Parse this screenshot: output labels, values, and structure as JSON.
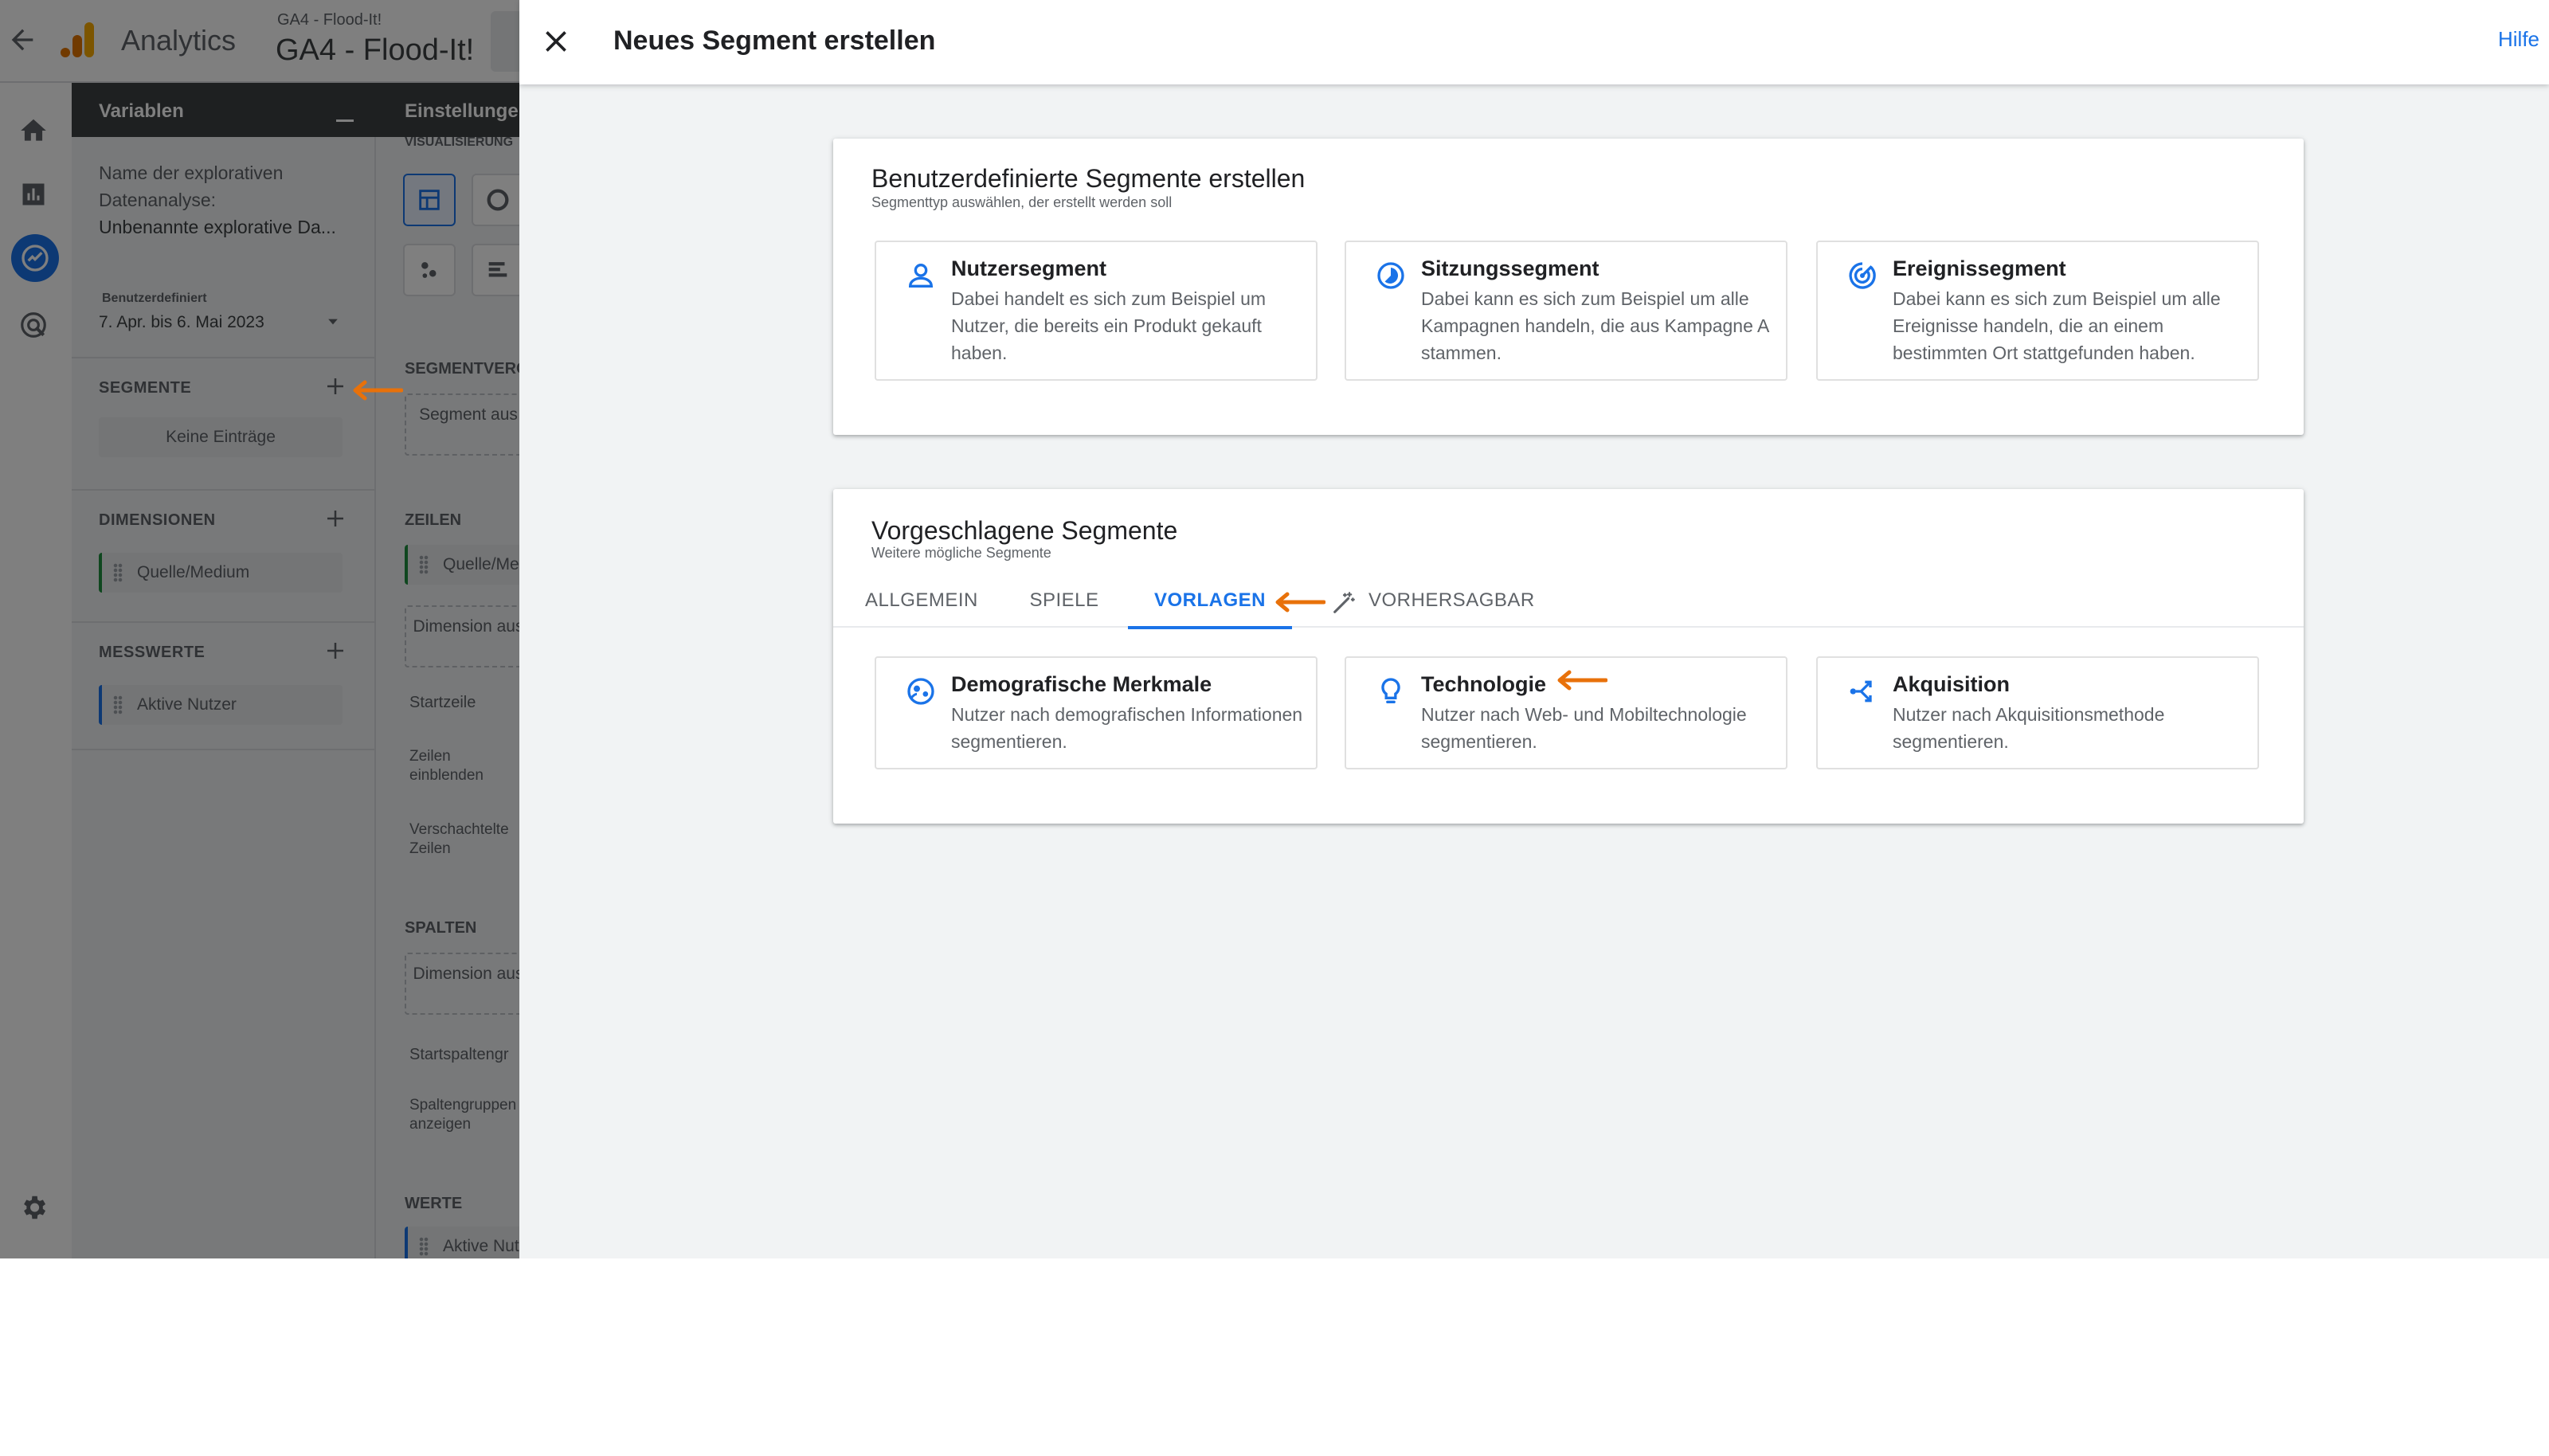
{
  "topbar": {
    "app_name": "Analytics",
    "property_small": "GA4 - Flood-It!",
    "property_big": "GA4 - Flood-It!"
  },
  "variables_panel": {
    "title": "Variablen",
    "exploration_name_label": "Name der explorativen Datenanalyse:",
    "exploration_name_value": "Unbenannte explorative Da...",
    "date_range_label": "Benutzerdefiniert",
    "date_range_value": "7. Apr. bis 6. Mai 2023",
    "segments_label": "SEGMENTE",
    "segments_empty": "Keine Einträge",
    "dimensions_label": "DIMENSIONEN",
    "dimension_item": "Quelle/Medium",
    "metrics_label": "MESSWERTE",
    "metric_item": "Aktive Nutzer"
  },
  "settings_panel": {
    "title": "Einstellungen",
    "visualization_label": "VISUALISIERUNG",
    "segment_compare_label": "SEGMENTVERG",
    "segment_drop": "Segment aus",
    "rows_label": "ZEILEN",
    "row_item": "Quelle/Me",
    "dimension_drop": "Dimension aus",
    "start_row": "Startzeile",
    "show_rows": "Zeilen einblenden",
    "nested_rows": "Verschachtelte Zeilen",
    "columns_label": "SPALTEN",
    "column_drop": "Dimension aus",
    "start_column_group": "Startspaltengr",
    "show_column_groups": "Spaltengruppen anzeigen",
    "values_label": "WERTE",
    "value_item": "Aktive Nut"
  },
  "dialog": {
    "title": "Neues Segment erstellen",
    "help": "Hilfe",
    "custom": {
      "title": "Benutzerdefinierte Segmente erstellen",
      "subtitle": "Segmenttyp auswählen, der erstellt werden soll",
      "options": [
        {
          "title": "Nutzersegment",
          "desc": "Dabei handelt es sich zum Beispiel um Nutzer, die bereits ein Produkt gekauft haben.",
          "icon": "person-icon"
        },
        {
          "title": "Sitzungssegment",
          "desc": "Dabei kann es sich zum Beispiel um alle Kampagnen handeln, die aus Kampagne A stammen.",
          "icon": "session-icon"
        },
        {
          "title": "Ereignissegment",
          "desc": "Dabei kann es sich zum Beispiel um alle Ereignisse handeln, die an einem bestimmten Ort stattgefunden haben.",
          "icon": "event-icon"
        }
      ]
    },
    "suggested": {
      "title": "Vorgeschlagene Segmente",
      "subtitle": "Weitere mögliche Segmente",
      "tabs": [
        "ALLGEMEIN",
        "SPIELE",
        "VORLAGEN",
        "VORHERSAGBAR"
      ],
      "active_tab": "VORLAGEN",
      "options": [
        {
          "title": "Demografische Merkmale",
          "desc": "Nutzer nach demografischen Informationen segmentieren.",
          "icon": "demographics-icon"
        },
        {
          "title": "Technologie",
          "desc": "Nutzer nach Web- und Mobiltechnologie segmentieren.",
          "icon": "lightbulb-icon"
        },
        {
          "title": "Akquisition",
          "desc": "Nutzer nach Akquisitionsmethode segmentieren.",
          "icon": "acquisition-icon"
        }
      ]
    }
  },
  "colors": {
    "accent": "#1a73e8",
    "annotation_arrow": "#e8710a",
    "ga_logo": "#f9ab00"
  }
}
